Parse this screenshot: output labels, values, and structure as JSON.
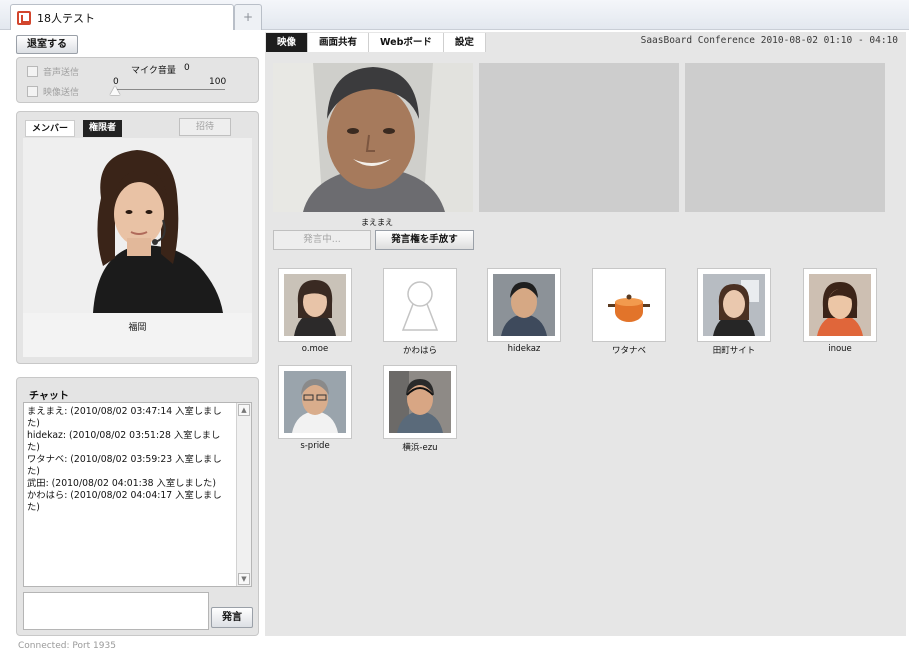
{
  "window": {
    "tab_title": "18人テスト",
    "new_tab_symbol": "+"
  },
  "left": {
    "leave_button": "退室する",
    "audio": {
      "send_audio_label": "音声送信",
      "send_video_label": "映像送信",
      "mic_volume_label": "マイク音量",
      "mic_volume_value": "0",
      "slider_min": "0",
      "slider_max": "100",
      "mic_volume_level": 0
    },
    "members": {
      "tab_members": "メンバー",
      "tab_authorized": "権限者",
      "invite_button": "招待",
      "selected_member_name": "福岡"
    },
    "chat": {
      "title": "チャット",
      "messages": [
        "まえまえ: (2010/08/02 03:47:14 入室しました)",
        "hidekaz: (2010/08/02 03:51:28 入室しました)",
        "ワタナベ: (2010/08/02 03:59:23 入室しました)",
        "武田: (2010/08/02 04:01:38 入室しました)",
        "かわはら: (2010/08/02 04:04:17 入室しました)"
      ],
      "input_value": "",
      "send_button": "発言"
    },
    "status": "Connected: Port 1935"
  },
  "main": {
    "tabs": [
      "映像",
      "画面共有",
      "Webボード",
      "設定"
    ],
    "active_tab": 0,
    "conference_title": "SaasBoard Conference  2010-08-02 01:10 - 04:10",
    "speaker_name": "まえまえ",
    "speaking_button": "発言中...",
    "release_button": "発言権を手放す",
    "participants": [
      {
        "name": "o.moe",
        "avatar": "woman-photo"
      },
      {
        "name": "かわはら",
        "avatar": "default-person-icon"
      },
      {
        "name": "hidekaz",
        "avatar": "man-photo"
      },
      {
        "name": "ワタナベ",
        "avatar": "pot-icon"
      },
      {
        "name": "田町サイト",
        "avatar": "woman-photo"
      },
      {
        "name": "inoue",
        "avatar": "woman-photo"
      },
      {
        "name": "s-pride",
        "avatar": "man-photo"
      },
      {
        "name": "横浜-ezu",
        "avatar": "man-photo"
      }
    ]
  },
  "colors": {
    "panel_bg": "#e4e4e4",
    "active_tab_bg": "#1d1d1d",
    "app_icon": "#d2452d"
  }
}
